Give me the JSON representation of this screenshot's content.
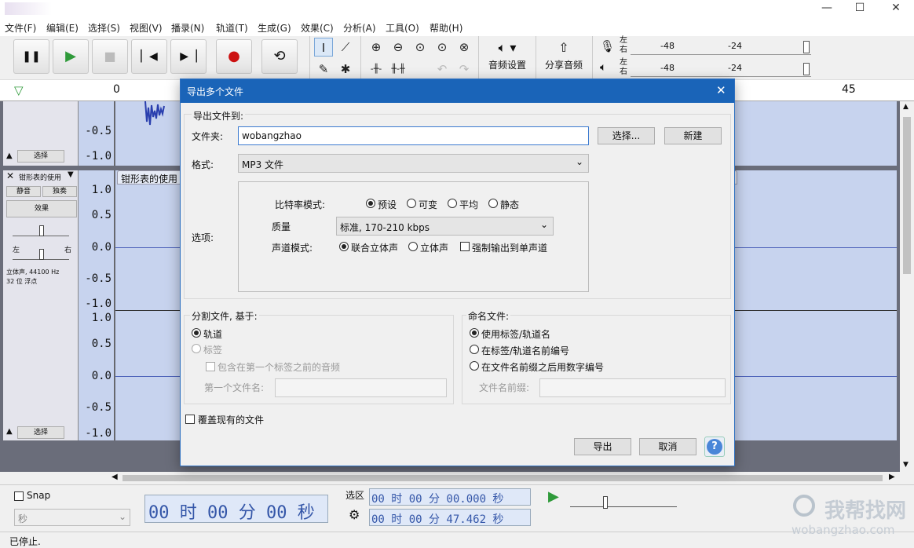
{
  "menu": [
    "文件(F)",
    "编辑(E)",
    "选择(S)",
    "视图(V)",
    "播录(N)",
    "轨道(T)",
    "生成(G)",
    "效果(C)",
    "分析(A)",
    "工具(O)",
    "帮助(H)"
  ],
  "toolbar": {
    "audio_setup": "音频设置",
    "share_audio": "分享音频",
    "meter_lr_top": "左",
    "meter_lr_bottom": "右",
    "meter_ticks": [
      "-48",
      "-24"
    ]
  },
  "ruler": {
    "start": "0",
    "end": "45"
  },
  "track1": {
    "scale": [
      "-0.5",
      "-1.0"
    ],
    "select_label": "选择"
  },
  "track2": {
    "name": "钳形表的使用",
    "mute": "静音",
    "solo": "独奏",
    "effects": "效果",
    "left": "左",
    "right": "右",
    "info_line1": "立体声, 44100 Hz",
    "info_line2": "32 位 浮点",
    "clip_name": "钳形表的使用",
    "select_label": "选择",
    "scale_upper": [
      "1.0",
      "0.5",
      "0.0",
      "-0.5",
      "-1.0"
    ],
    "scale_lower": [
      "1.0",
      "0.5",
      "0.0",
      "-0.5",
      "-1.0"
    ]
  },
  "dialog": {
    "title": "导出多个文件",
    "export_to": "导出文件到:",
    "folder_label": "文件夹:",
    "folder_value": "wobangzhao",
    "choose_button": "选择...",
    "new_button": "新建",
    "format_label": "格式:",
    "format_value": "MP3 文件",
    "options_label": "选项:",
    "bitrate_label": "比特率模式:",
    "bitrate_options": [
      "预设",
      "可变",
      "平均",
      "静态"
    ],
    "quality_label": "质量",
    "quality_value": "标准, 170-210 kbps",
    "channel_label": "声道模式:",
    "channel_options": [
      "联合立体声",
      "立体声"
    ],
    "force_mono": "强制输出到单声道",
    "split_title": "分割文件, 基于:",
    "split_tracks": "轨道",
    "split_labels": "标签",
    "include_audio": "包含在第一个标签之前的音频",
    "first_filename": "第一个文件名:",
    "naming_title": "命名文件:",
    "naming_options": [
      "使用标签/轨道名",
      "在标签/轨道名前编号",
      "在文件名前缀之后用数字编号"
    ],
    "prefix_label": "文件名前缀:",
    "overwrite": "覆盖现有的文件",
    "export_button": "导出",
    "cancel_button": "取消",
    "help_button": "?"
  },
  "bottom": {
    "snap": "Snap",
    "unit": "秒",
    "time_main": "00 时 00 分 00 秒",
    "selection_label": "选区",
    "sel_start": "00 时 00 分 00.000 秒",
    "sel_end": "00 时 00 分 47.462 秒"
  },
  "status": "已停止.",
  "watermark": {
    "text": "我帮找网",
    "url": "wobangzhao.com"
  }
}
